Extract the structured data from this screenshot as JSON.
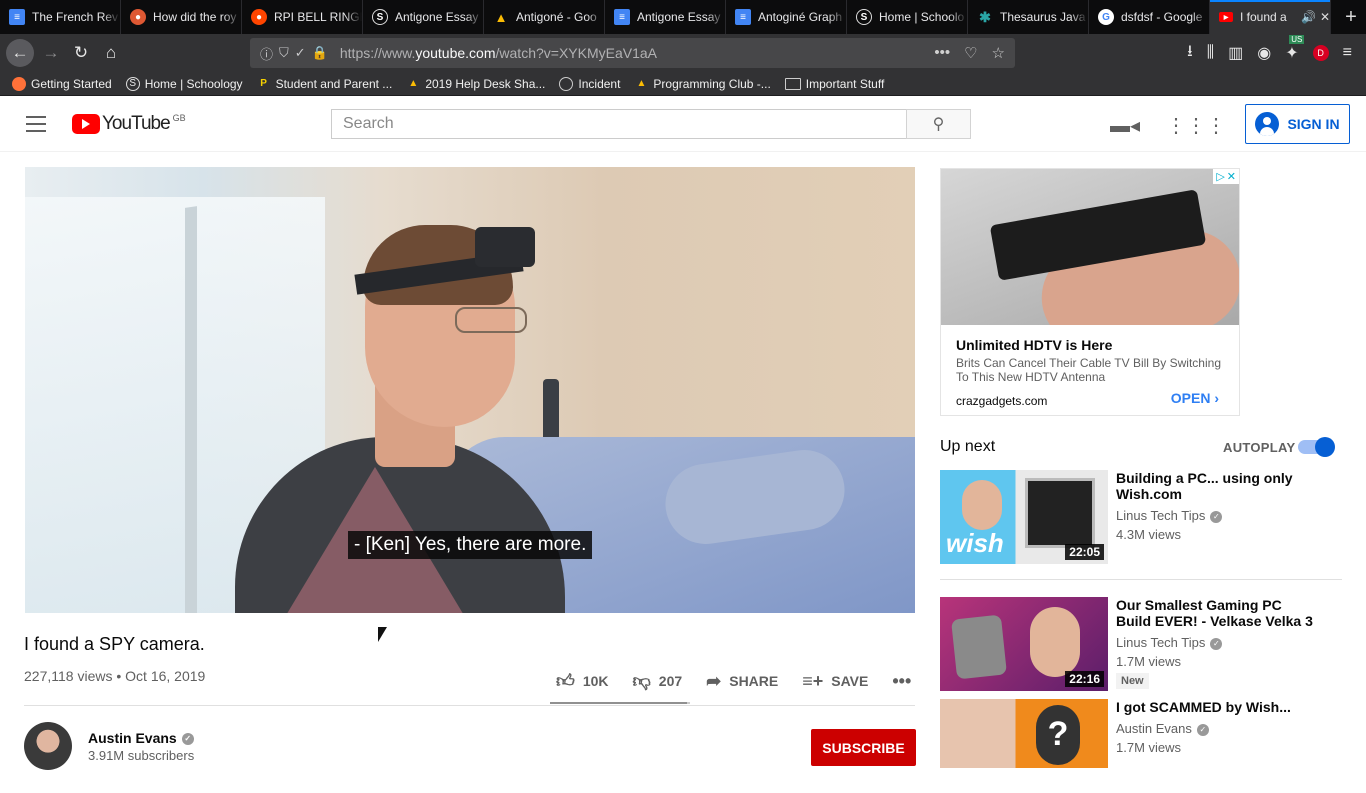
{
  "browser": {
    "tabs": [
      {
        "title": "The French Rev",
        "favicon": "doc-icon",
        "color": "#4285f4"
      },
      {
        "title": "How did the roy",
        "favicon": "duckduckgo-icon",
        "color": "#de5833"
      },
      {
        "title": "RPI BELL RINGE",
        "favicon": "reddit-icon",
        "color": "#ff4500"
      },
      {
        "title": "Antigone Essay",
        "favicon": "schoology-icon",
        "color": "#444"
      },
      {
        "title": "Antigoné - Goo",
        "favicon": "drive-icon",
        "color": "#fbbc04"
      },
      {
        "title": "Antigone Essay",
        "favicon": "doc-icon",
        "color": "#4285f4"
      },
      {
        "title": "Antoginé Graph",
        "favicon": "doc-icon",
        "color": "#4285f4"
      },
      {
        "title": "Home | Schoolo",
        "favicon": "schoology-icon",
        "color": "#444"
      },
      {
        "title": "Thesaurus Java",
        "favicon": "puzzle-icon",
        "color": "#2aa6a6"
      },
      {
        "title": "dsfdsf - Google",
        "favicon": "google-icon",
        "color": "#fff"
      },
      {
        "title": "I found a",
        "favicon": "youtube-icon",
        "color": "#ff0000",
        "active": true
      }
    ],
    "url_prefix": "https://www.",
    "url_domain": "youtube.com",
    "url_path": "/watch?v=XYKMyEaV1aA",
    "bookmarks": [
      {
        "label": "Getting Started",
        "icon": "firefox-icon"
      },
      {
        "label": "Home | Schoology",
        "icon": "schoology-icon"
      },
      {
        "label": "Student and Parent ...",
        "icon": "p-icon"
      },
      {
        "label": "2019 Help Desk Sha...",
        "icon": "drive-icon"
      },
      {
        "label": "Incident",
        "icon": "globe-icon"
      },
      {
        "label": "Programming Club -...",
        "icon": "drive-icon"
      },
      {
        "label": "Important Stuff",
        "icon": "folder-icon"
      }
    ],
    "profile_initial": "D",
    "extension_badge": "US"
  },
  "youtube": {
    "logo_text": "YouTube",
    "country_code": "GB",
    "search_placeholder": "Search",
    "signin_label": "SIGN IN"
  },
  "video": {
    "caption": "- [Ken] Yes, there are more.",
    "title": "I found a SPY camera.",
    "views_date": "227,118 views • Oct 16, 2019",
    "likes": "10K",
    "dislikes": "207",
    "share_label": "SHARE",
    "save_label": "SAVE",
    "like_ratio": 0.98,
    "channel_name": "Austin Evans",
    "subscribers": "3.91M subscribers",
    "subscribe_label": "SUBSCRIBE"
  },
  "ad": {
    "title": "Unlimited HDTV is Here",
    "description": "Brits Can Cancel Their Cable TV Bill By Switching To This New HDTV Antenna",
    "domain": "crazgadgets.com",
    "cta": "OPEN"
  },
  "up_next": {
    "heading": "Up next",
    "autoplay_label": "AUTOPLAY",
    "autoplay_on": true,
    "videos": [
      {
        "title": "Building a PC... using only Wish.com",
        "channel": "Linus Tech Tips",
        "views": "4.3M views",
        "duration": "22:05",
        "badge": ""
      },
      {
        "title": "Our Smallest Gaming PC Build EVER! - Velkase Velka 3",
        "channel": "Linus Tech Tips",
        "views": "1.7M views",
        "duration": "22:16",
        "badge": "New"
      },
      {
        "title": "I got SCAMMED by Wish...",
        "channel": "Austin Evans",
        "views": "1.7M views",
        "duration": "",
        "badge": ""
      }
    ]
  }
}
